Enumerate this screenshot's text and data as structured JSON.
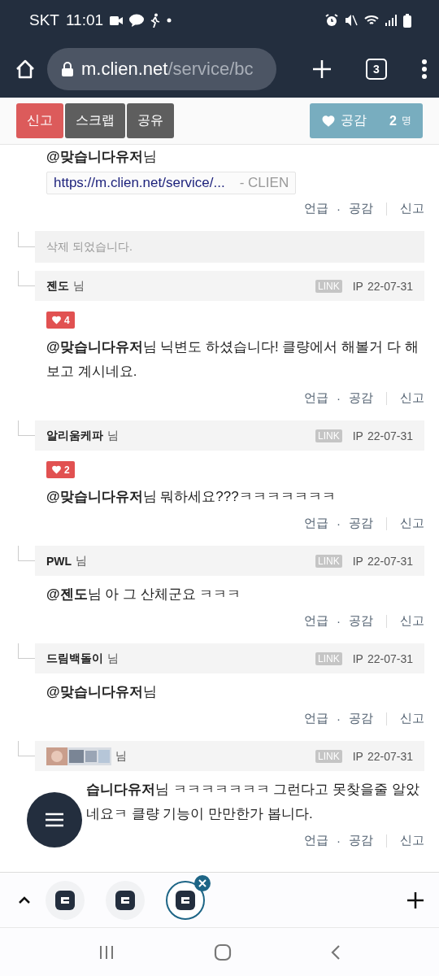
{
  "status_bar": {
    "carrier": "SKT",
    "time": "11:01"
  },
  "browser": {
    "url_host": "m.clien.net",
    "url_path": "/service/bc",
    "tab_count": "3"
  },
  "post_actions": {
    "buttons": [
      {
        "label": "신고",
        "kind": "report"
      },
      {
        "label": "스크랩",
        "kind": "plain"
      },
      {
        "label": "공유",
        "kind": "plain"
      }
    ],
    "like": {
      "label": "공감",
      "count": "2",
      "unit": "명"
    }
  },
  "comments": [
    {
      "kind": "partial",
      "body": "**@맞습니다유저**님",
      "link_card": {
        "url": "https://m.clien.net/service/...",
        "site": "- CLIEN"
      },
      "actions": [
        "언급",
        "·",
        "공감",
        "신고"
      ]
    },
    {
      "kind": "deleted",
      "body": "삭제 되었습니다."
    },
    {
      "kind": "comment",
      "author": "젠도",
      "suffix": "님",
      "link_badge": "LINK",
      "ip": "IP",
      "date": "22-07-31",
      "likes": "4",
      "body": "**@맞습니다유저**님 닉변도 하셨습니다! 클량에서 해볼거 다 해보고 계시네요.",
      "actions": [
        "언급",
        "·",
        "공감",
        "신고"
      ]
    },
    {
      "kind": "comment",
      "author": "알리움케파",
      "suffix": "님",
      "link_badge": "LINK",
      "ip": "IP",
      "date": "22-07-31",
      "likes": "2",
      "body": "**@맞습니다유저**님 뭐하세요???ㅋㅋㅋㅋㅋㅋㅋ",
      "actions": [
        "언급",
        "·",
        "공감",
        "신고"
      ]
    },
    {
      "kind": "comment",
      "author": "PWL",
      "suffix": "님",
      "link_badge": "LINK",
      "ip": "IP",
      "date": "22-07-31",
      "body": "**@젠도**님 아 그 산체군요 ㅋㅋㅋ",
      "actions": [
        "언급",
        "·",
        "공감",
        "신고"
      ]
    },
    {
      "kind": "comment",
      "author": "드림백돌이",
      "suffix": "님",
      "link_badge": "LINK",
      "ip": "IP",
      "date": "22-07-31",
      "body": "**@맞습니다유저**님",
      "actions": [
        "언급",
        "·",
        "공감",
        "신고"
      ]
    },
    {
      "kind": "comment",
      "suffix": "님",
      "link_badge": "LINK",
      "ip": "IP",
      "date": "22-07-31",
      "body": "**습니다유저**님 ㅋㅋㅋㅋㅋㅋㅋ 그런다고 못찾을줄 알았네요ㅋ 클량 기능이 만만한가 봅니다.",
      "actions": [
        "언급",
        "·",
        "공감",
        "신고"
      ]
    }
  ],
  "tab_strip": {
    "tabs": [
      {
        "selected": false
      },
      {
        "selected": false
      },
      {
        "selected": true
      }
    ]
  }
}
